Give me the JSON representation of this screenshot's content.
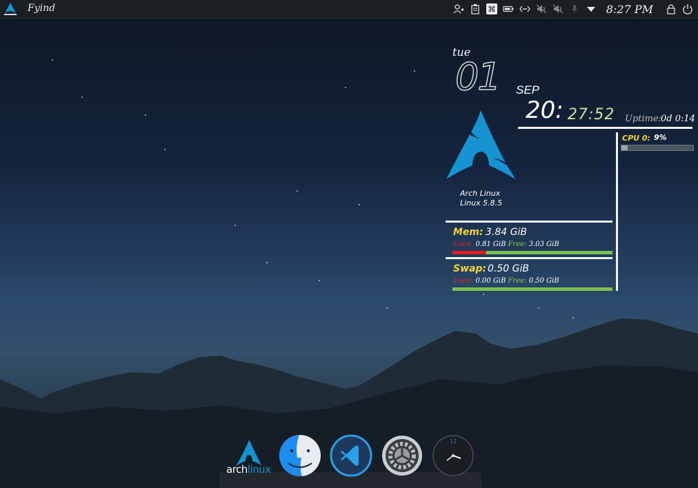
{
  "panel": {
    "app_name": "Fyind",
    "clock": "8:27 PM",
    "tray_icons": [
      "user-switch-icon",
      "clipboard-icon",
      "command-icon",
      "battery-icon",
      "network-icon",
      "volume-muted-icon",
      "volume-muted-icon",
      "microphone-icon",
      "dropdown-icon",
      "lock-icon",
      "power-icon"
    ]
  },
  "conky": {
    "day": "tue",
    "date": "01",
    "month": "SEP",
    "hour": "20:",
    "minutes": "27:52",
    "uptime_label": "Uptime:",
    "uptime_value": "0d 0:14",
    "os_name": "Arch Linux",
    "kernel": "Linux 5.8.5",
    "cpu": {
      "label": "CPU 0:",
      "value": "9%",
      "percent": 9
    },
    "mem": {
      "label": "Mem:",
      "value": "3.84 GiB",
      "used_label": "Used:",
      "used": "0.81 GiB",
      "free_label": "Free:",
      "free": "3.03 GiB",
      "used_fraction": 0.21
    },
    "swap": {
      "label": "Swap:",
      "value": "0.50 GiB",
      "used_label": "Used:",
      "used": "0.00 GiB",
      "free_label": "Free:",
      "free": "0.50 GiB",
      "used_fraction": 0.0
    },
    "colors": {
      "label_yellow": "#f2d23c",
      "used_red": "#e0262a",
      "free_green": "#8ed24e",
      "arch_blue": "#1793d1"
    }
  },
  "dock": {
    "arch_label_a": "arch",
    "arch_label_b": "linux",
    "items": [
      "arch-linux-icon",
      "finder-icon",
      "vscode-icon",
      "settings-icon",
      "clock-app-icon"
    ]
  }
}
